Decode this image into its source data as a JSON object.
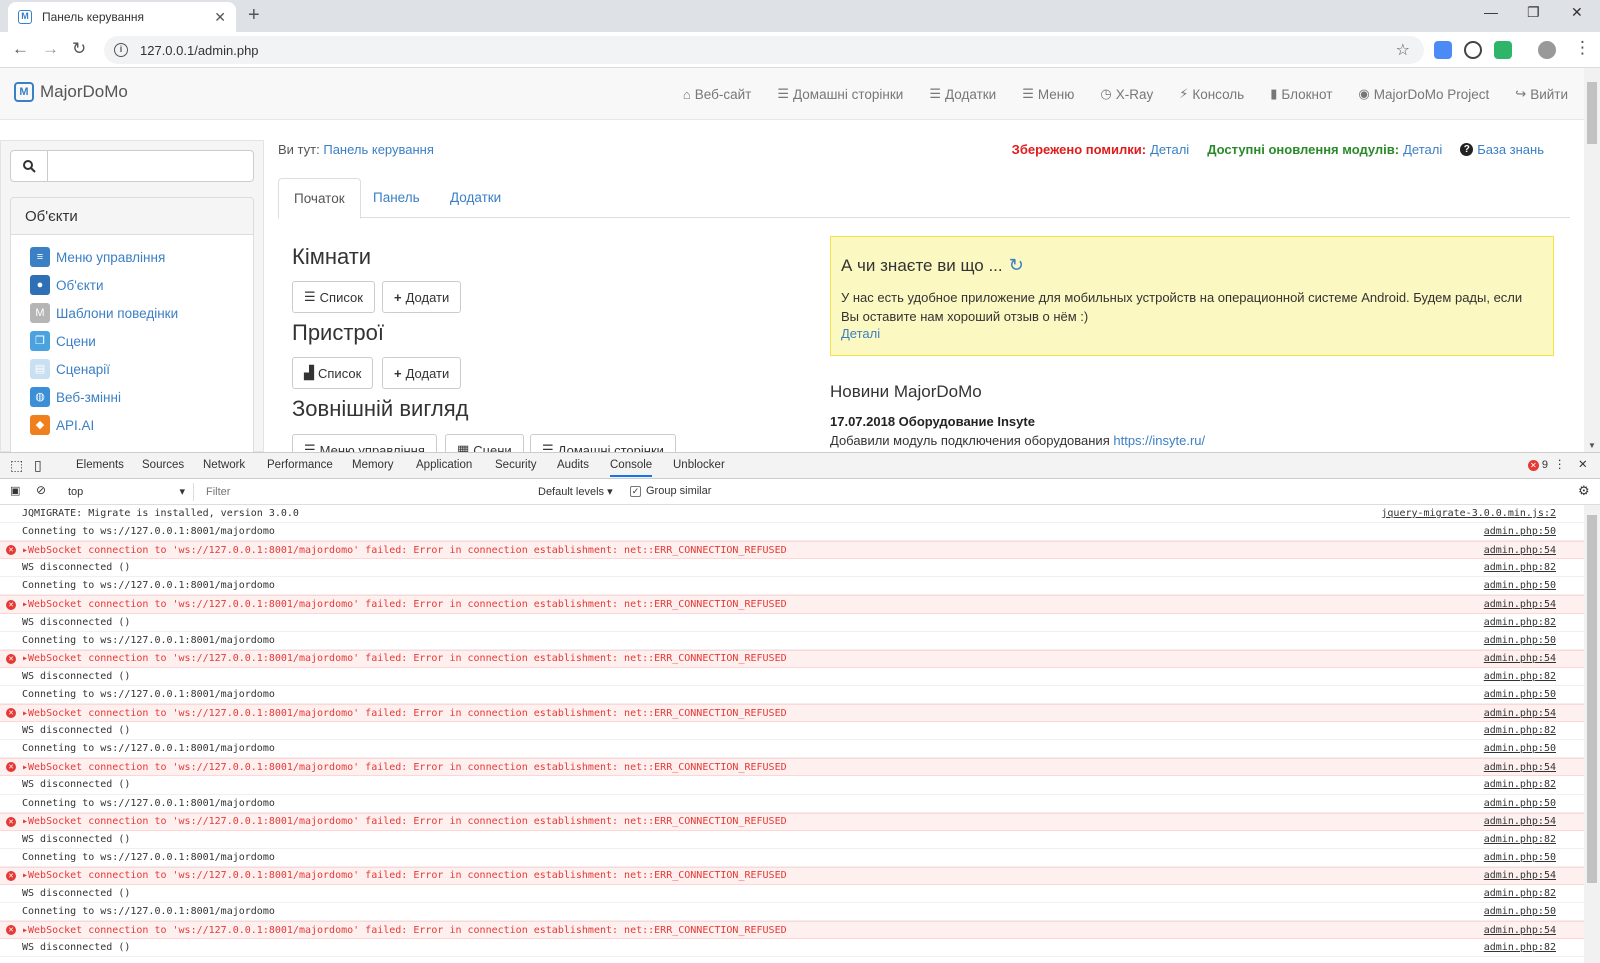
{
  "browser": {
    "tab_title": "Панель керування",
    "url": "127.0.0.1/admin.php"
  },
  "navbar": {
    "brand": "MajorDoMo",
    "links": [
      {
        "icon": "home-icon",
        "glyph": "⌂",
        "label": "Веб-сайт"
      },
      {
        "icon": "grid-icon",
        "glyph": "☰",
        "label": "Домашні сторінки"
      },
      {
        "icon": "grid-icon",
        "glyph": "☰",
        "label": "Додатки"
      },
      {
        "icon": "list-icon",
        "glyph": "☰",
        "label": "Меню"
      },
      {
        "icon": "clock-icon",
        "glyph": "◷",
        "label": "X-Ray"
      },
      {
        "icon": "bolt-icon",
        "glyph": "⚡",
        "label": "Консоль"
      },
      {
        "icon": "book-icon",
        "glyph": "▮",
        "label": "Блокнот"
      },
      {
        "icon": "globe-icon",
        "glyph": "◉",
        "label": "MajorDoMo Project"
      },
      {
        "icon": "logout-icon",
        "glyph": "↪",
        "label": "Вийти"
      }
    ]
  },
  "sidebar": {
    "search_placeholder": "",
    "panel_title": "Об'єкти",
    "items": [
      {
        "label": "Меню управління",
        "icon": "menu-icon",
        "color": "#3b7fc4",
        "glyph": "≡"
      },
      {
        "label": "Об'єкти",
        "icon": "globe-icon",
        "color": "#2f6fb5",
        "glyph": "●"
      },
      {
        "label": "Шаблони поведінки",
        "icon": "template-icon",
        "color": "#b5b5b5",
        "glyph": "M"
      },
      {
        "label": "Сцени",
        "icon": "scenes-icon",
        "color": "#4aa3df",
        "glyph": "❐"
      },
      {
        "label": "Сценарії",
        "icon": "scripts-icon",
        "color": "#c9dff2",
        "glyph": "▤"
      },
      {
        "label": "Веб-змінні",
        "icon": "web-vars-icon",
        "color": "#3b8fd6",
        "glyph": "◍"
      },
      {
        "label": "API.AI",
        "icon": "api-icon",
        "color": "#f07f1e",
        "glyph": "◆"
      }
    ]
  },
  "breadcrumb": {
    "prefix": "Ви тут:",
    "link": "Панель керування"
  },
  "alerts": {
    "errors_label": "Збережено помилки:",
    "errors_link": "Деталі",
    "updates_label": "Доступні оновлення модулів:",
    "updates_link": "Деталі",
    "kb_label": "База знань"
  },
  "tabs": [
    "Початок",
    "Панель",
    "Додатки"
  ],
  "sections": {
    "rooms": {
      "title": "Кімнати",
      "list": "Список",
      "add": "Додати"
    },
    "devices": {
      "title": "Пристрої",
      "list": "Список",
      "add": "Додати"
    },
    "appearance": {
      "title": "Зовнішній вигляд",
      "b1": "Меню управління",
      "b2": "Сцени",
      "b3": "Домашні сторінки"
    }
  },
  "tip": {
    "title": "А чи знаєте ви що ...",
    "text": "У нас есть удобное приложение для мобильных устройств на операционной системе Android. Будем рады, если Вы оставите нам хороший отзыв о нём :)",
    "link": "Деталі"
  },
  "news": {
    "title": "Новини MajorDoMo",
    "date_title": "17.07.2018 Оборудование Insyte",
    "text": "Добавили модуль подключения оборудования",
    "link": "https://insyte.ru/"
  },
  "devtools": {
    "tabs": [
      "Elements",
      "Sources",
      "Network",
      "Performance",
      "Memory",
      "Application",
      "Security",
      "Audits",
      "Console",
      "Unblocker"
    ],
    "active_tab": "Console",
    "error_count": "9",
    "context": "top",
    "filter_placeholder": "Filter",
    "levels": "Default levels",
    "group_similar": "Group similar",
    "logs": [
      {
        "type": "info",
        "msg": "JQMIGRATE: Migrate is installed, version 3.0.0",
        "src": "jquery-migrate-3.0.0.min.js:2"
      },
      {
        "type": "info",
        "msg": "Conneting to ws://127.0.0.1:8001/majordomo",
        "src": "admin.php:50"
      },
      {
        "type": "error",
        "msg": "WebSocket connection to 'ws://127.0.0.1:8001/majordomo' failed: Error in connection establishment: net::ERR_CONNECTION_REFUSED",
        "src": "admin.php:54"
      },
      {
        "type": "info",
        "msg": "WS disconnected ()",
        "src": "admin.php:82"
      },
      {
        "type": "info",
        "msg": "Conneting to ws://127.0.0.1:8001/majordomo",
        "src": "admin.php:50"
      },
      {
        "type": "error",
        "msg": "WebSocket connection to 'ws://127.0.0.1:8001/majordomo' failed: Error in connection establishment: net::ERR_CONNECTION_REFUSED",
        "src": "admin.php:54"
      },
      {
        "type": "info",
        "msg": "WS disconnected ()",
        "src": "admin.php:82"
      },
      {
        "type": "info",
        "msg": "Conneting to ws://127.0.0.1:8001/majordomo",
        "src": "admin.php:50"
      },
      {
        "type": "error",
        "msg": "WebSocket connection to 'ws://127.0.0.1:8001/majordomo' failed: Error in connection establishment: net::ERR_CONNECTION_REFUSED",
        "src": "admin.php:54"
      },
      {
        "type": "info",
        "msg": "WS disconnected ()",
        "src": "admin.php:82"
      },
      {
        "type": "info",
        "msg": "Conneting to ws://127.0.0.1:8001/majordomo",
        "src": "admin.php:50"
      },
      {
        "type": "error",
        "msg": "WebSocket connection to 'ws://127.0.0.1:8001/majordomo' failed: Error in connection establishment: net::ERR_CONNECTION_REFUSED",
        "src": "admin.php:54"
      },
      {
        "type": "info",
        "msg": "WS disconnected ()",
        "src": "admin.php:82"
      },
      {
        "type": "info",
        "msg": "Conneting to ws://127.0.0.1:8001/majordomo",
        "src": "admin.php:50"
      },
      {
        "type": "error",
        "msg": "WebSocket connection to 'ws://127.0.0.1:8001/majordomo' failed: Error in connection establishment: net::ERR_CONNECTION_REFUSED",
        "src": "admin.php:54"
      },
      {
        "type": "info",
        "msg": "WS disconnected ()",
        "src": "admin.php:82"
      },
      {
        "type": "info",
        "msg": "Conneting to ws://127.0.0.1:8001/majordomo",
        "src": "admin.php:50"
      },
      {
        "type": "error",
        "msg": "WebSocket connection to 'ws://127.0.0.1:8001/majordomo' failed: Error in connection establishment: net::ERR_CONNECTION_REFUSED",
        "src": "admin.php:54"
      },
      {
        "type": "info",
        "msg": "WS disconnected ()",
        "src": "admin.php:82"
      },
      {
        "type": "info",
        "msg": "Conneting to ws://127.0.0.1:8001/majordomo",
        "src": "admin.php:50"
      },
      {
        "type": "error",
        "msg": "WebSocket connection to 'ws://127.0.0.1:8001/majordomo' failed: Error in connection establishment: net::ERR_CONNECTION_REFUSED",
        "src": "admin.php:54"
      },
      {
        "type": "info",
        "msg": "WS disconnected ()",
        "src": "admin.php:82"
      },
      {
        "type": "info",
        "msg": "Conneting to ws://127.0.0.1:8001/majordomo",
        "src": "admin.php:50"
      },
      {
        "type": "error",
        "msg": "WebSocket connection to 'ws://127.0.0.1:8001/majordomo' failed: Error in connection establishment: net::ERR_CONNECTION_REFUSED",
        "src": "admin.php:54"
      },
      {
        "type": "info",
        "msg": "WS disconnected ()",
        "src": "admin.php:82"
      }
    ]
  }
}
